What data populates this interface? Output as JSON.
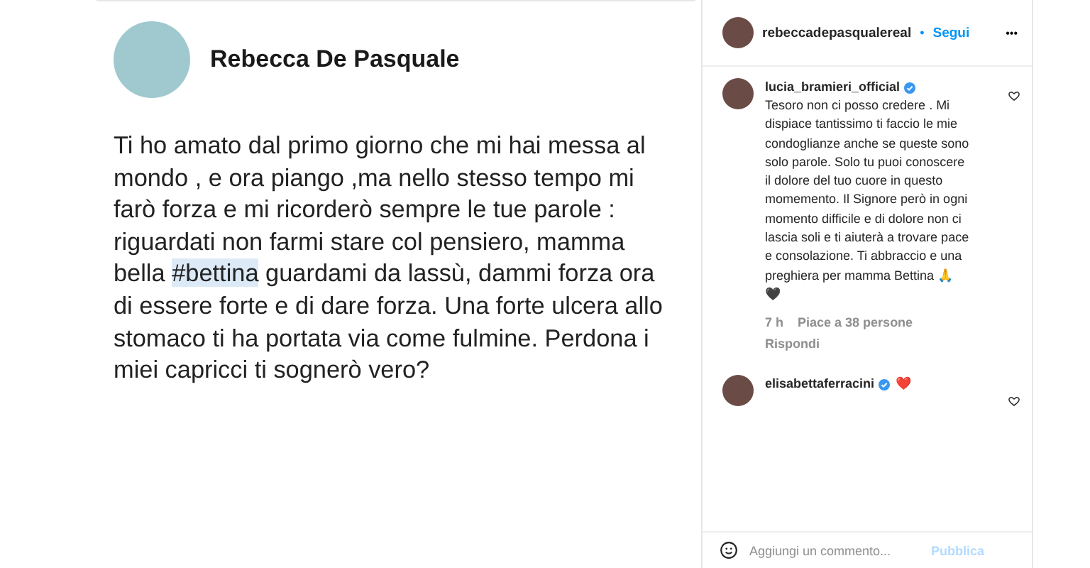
{
  "post": {
    "author": "Rebecca De Pasquale",
    "text_before": "Ti ho amato dal primo giorno che mi hai messa al mondo , e ora piango ,ma nello stesso tempo mi farò forza e mi ricorderò sempre le tue parole : riguardati non farmi stare col pensiero,  mamma bella",
    "hashtag": "#bettina",
    "text_after": "guardami da lassù,  dammi forza ora di essere forte e di dare forza. Una forte ulcera allo stomaco ti ha portata via come fulmine. Perdona i miei capricci ti sognerò vero?"
  },
  "panel": {
    "username": "rebeccadepasqualereal",
    "dot": "•",
    "follow": "Segui",
    "more": "•••",
    "comments": [
      {
        "user": "lucia_bramieri_official",
        "verified": true,
        "text": "Tesoro non ci posso credere . Mi dispiace tantissimo ti faccio le mie condoglianze anche se queste sono solo parole. Solo tu puoi conoscere il dolore del tuo cuore in questo momemento. Il Signore però in ogni momento difficile e di dolore non ci lascia soli e ti aiuterà a trovare pace e consolazione. Ti abbraccio e una preghiera per mamma Bettina 🙏 🖤",
        "time": "7 h",
        "likes": "Piace a 38 persone",
        "reply": "Rispondi"
      },
      {
        "user": "elisabettaferracini",
        "verified": true,
        "text": "❤️"
      }
    ],
    "comment_placeholder": "Aggiungi un commento...",
    "publish": "Pubblica"
  }
}
